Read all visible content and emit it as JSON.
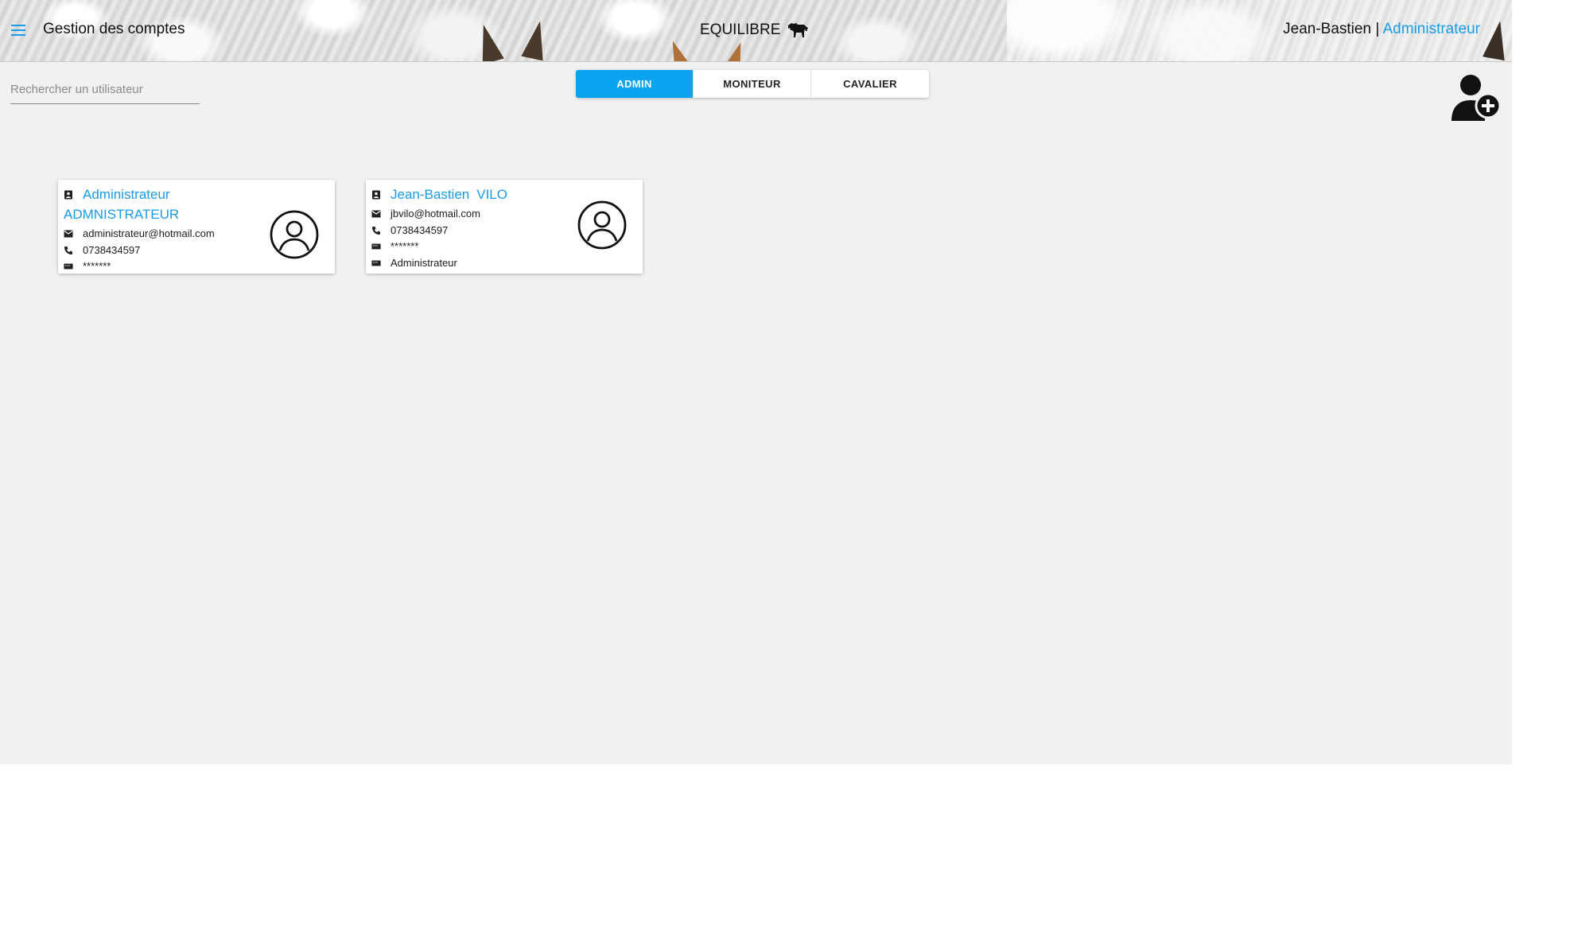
{
  "header": {
    "title": "Gestion des comptes",
    "brand": "EQUILIBRE",
    "user_name": "Jean-Bastien",
    "separator": "|",
    "user_role": "Administrateur"
  },
  "search": {
    "placeholder": "Rechercher un utilisateur",
    "value": ""
  },
  "tabs": [
    {
      "label": "ADMIN",
      "active": true
    },
    {
      "label": "MONITEUR",
      "active": false
    },
    {
      "label": "CAVALIER",
      "active": false
    }
  ],
  "colors": {
    "accent": "#1a9be6",
    "tab_active": "#0aa3f0",
    "background": "#f1f1f1"
  },
  "cards": [
    {
      "first_name": "Administrateur",
      "last_name": "ADMNISTRATEUR",
      "email": "administrateur@hotmail.com",
      "phone": "0738434597",
      "password": "*******"
    },
    {
      "first_name": "Jean-Bastien",
      "last_name": "VILO",
      "email": "jbvilo@hotmail.com",
      "phone": "0738434597",
      "password": "*******",
      "role": "Administrateur"
    }
  ],
  "icons": {
    "menu": "menu-icon",
    "brand": "horse-icon",
    "add_user": "add-user-icon",
    "contact": "contact-card-icon",
    "email": "email-icon",
    "phone": "phone-icon",
    "password": "password-icon",
    "avatar": "user-circle-icon"
  }
}
